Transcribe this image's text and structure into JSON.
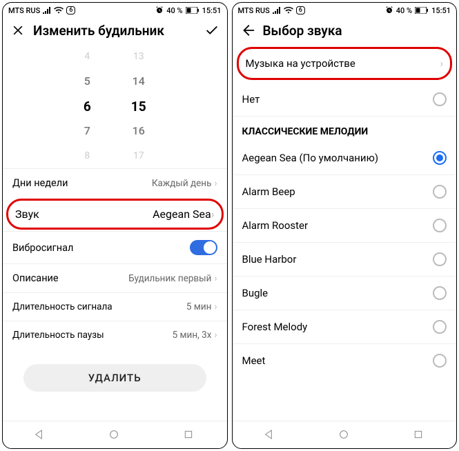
{
  "statusbar": {
    "carrier": "MTS RUS",
    "notif_badge": "6",
    "battery": "40 %",
    "time": "15:51"
  },
  "left": {
    "title": "Изменить будильник",
    "wheel": {
      "hours": [
        "4",
        "5",
        "6",
        "7",
        "8"
      ],
      "minutes": [
        "13",
        "14",
        "15",
        "16",
        "17"
      ]
    },
    "rows": {
      "days": {
        "label": "Дни недели",
        "value": "Каждый день"
      },
      "sound": {
        "label": "Звук",
        "value": "Aegean Sea"
      },
      "vibro": {
        "label": "Вибросигнал"
      },
      "desc": {
        "label": "Описание",
        "value": "Будильник первый"
      },
      "sig_len": {
        "label": "Длительность сигнала",
        "value": "5 мин"
      },
      "pause": {
        "label": "Длительность паузы",
        "value": "5 мин, 3x"
      }
    },
    "delete_label": "УДАЛИТЬ"
  },
  "right": {
    "title": "Выбор звука",
    "device_music": "Музыка на устройстве",
    "none": "Нет",
    "section": "КЛАССИЧЕСКИЕ МЕЛОДИИ",
    "options": {
      "o0": "Aegean Sea (По умолчанию)",
      "o1": "Alarm Beep",
      "o2": "Alarm Rooster",
      "o3": "Blue Harbor",
      "o4": "Bugle",
      "o5": "Forest Melody",
      "o6": "Meet"
    }
  }
}
